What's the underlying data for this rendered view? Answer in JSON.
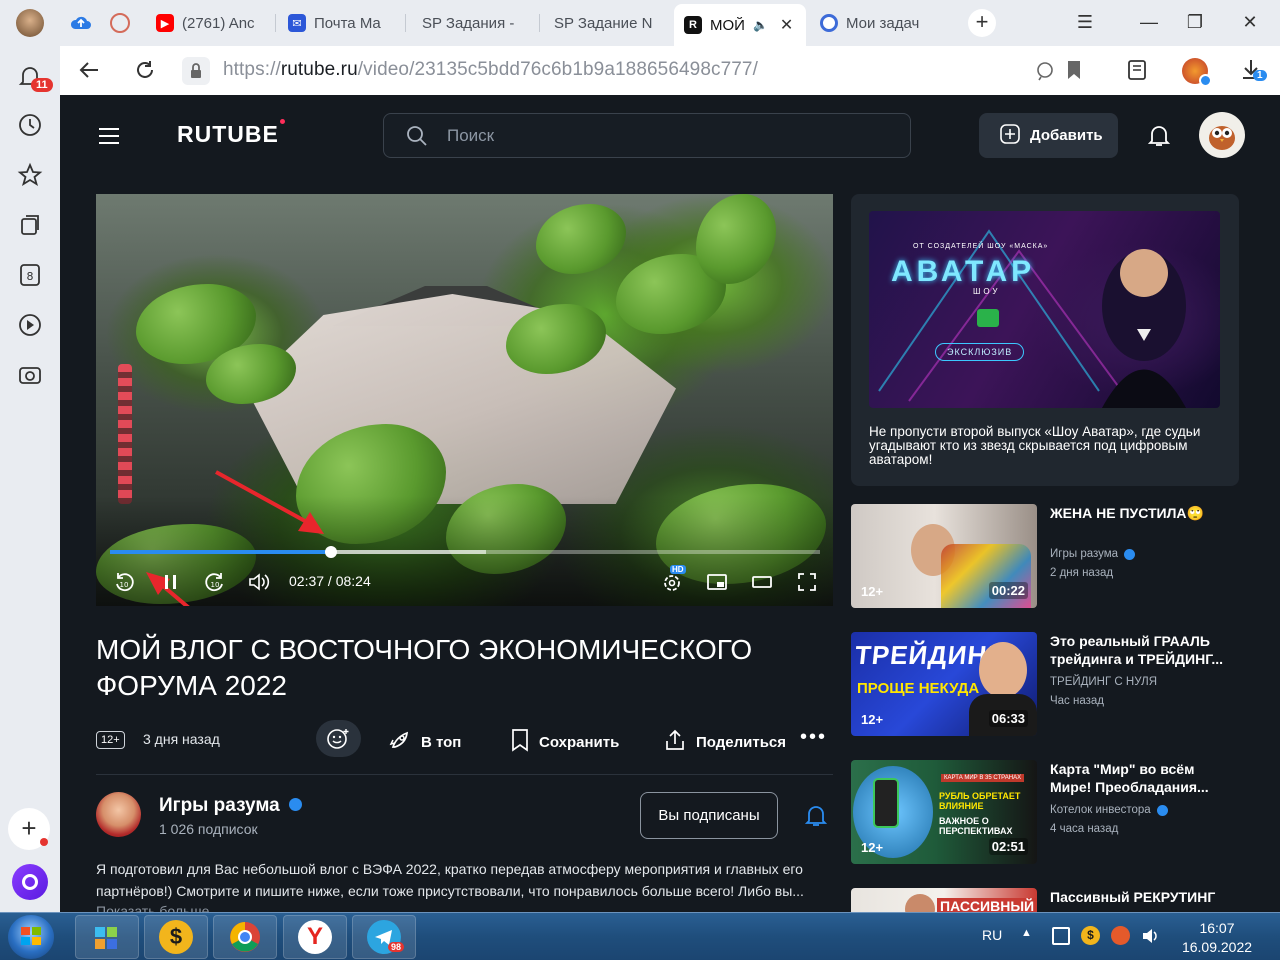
{
  "browser": {
    "tabs": [
      {
        "label": "(2761) Anc",
        "favicon": "youtube-icon",
        "color": "#ff0000"
      },
      {
        "label": "Почта Ma",
        "favicon": "mail-icon",
        "color": "#2c57d8"
      },
      {
        "label": "SP Задания -",
        "favicon": "sp-icon",
        "color": "#e0356b"
      },
      {
        "label": "SP Задание N",
        "favicon": "sp-icon",
        "color": "#e0356b"
      },
      {
        "label": "МОЙ",
        "favicon": "rutube-icon",
        "color": "#111111",
        "active": true
      },
      {
        "label": "Мои задач",
        "favicon": "target-icon",
        "color": "#3d6bd8"
      }
    ],
    "url_scheme": "https://",
    "url_host": "rutube.ru",
    "url_path": "/video/23135c5bdd76c6b1b9a188656498c777/",
    "notification_count": "11",
    "downloads_count": "1"
  },
  "site": {
    "logo": "RUTUBE",
    "search_placeholder": "Поиск",
    "add_button": "Добавить",
    "accent": "#2a8cf0"
  },
  "player": {
    "current_time": "02:37",
    "duration": "08:24",
    "time_display": "02:37 / 08:24",
    "progress_fraction": 0.3115,
    "buffered_fraction": 0.53,
    "quality_badge": "HD"
  },
  "video": {
    "title": "МОЙ ВЛОГ С ВОСТОЧНОГО ЭКОНОМИЧЕСКОГО ФОРУМА 2022",
    "age_rating": "12+",
    "posted": "3 дня назад",
    "actions": {
      "top": "В топ",
      "save": "Сохранить",
      "share": "Поделиться"
    }
  },
  "channel": {
    "name": "Игры разума",
    "subscribers": "1 026 подписок",
    "subscribe_button": "Вы подписаны"
  },
  "description": {
    "text": "Я подготовил для Вас небольшой влог с ВЭФА 2022, кратко передав атмосферу мероприятия и главных его партнёров!) Смотрите и пишите ниже, если тоже присутствовали, что понравилось больше всего! Либо вы...",
    "more": "Показать больше"
  },
  "sidebar": {
    "promo": {
      "caption": "Не пропусти второй выпуск «Шоу Аватар», где судьи угадывают кто из звезд скрывается под цифровым аватаром!",
      "img_top": "ОТ СОЗДАТЕЛЕЙ ШОУ «МАСКА»",
      "img_title": "АВАТАР",
      "img_sub": "ШОУ",
      "img_badge": "ЭКСКЛЮЗИВ"
    },
    "recommendations": [
      {
        "title": "ЖЕНА НЕ ПУСТИЛА🙄",
        "channel": "Игры разума",
        "verified": true,
        "date": "2 дня назад",
        "age": "12+",
        "duration": "00:22"
      },
      {
        "title": "Это реальный ГРААЛЬ трейдинга и ТРЕЙДИНГ...",
        "channel": "ТРЕЙДИНГ С НУЛЯ",
        "verified": false,
        "date": "Час назад",
        "age": "12+",
        "duration": "06:33",
        "thumb_text1": "ТРЕЙДИНГ",
        "thumb_text2": "ПРОЩЕ НЕКУДА"
      },
      {
        "title": "Карта \"Мир\" во всём Мире! Преобладания...",
        "channel": "Котелок инвестора",
        "verified": true,
        "date": "4 часа назад",
        "age": "12+",
        "duration": "02:51",
        "thumb_text1": "КАРТА МИР В 35 СТРАНАХ",
        "thumb_text2": "РУБЛЬ ОБРЕТАЕТ ВЛИЯНИЕ",
        "thumb_text3": "ВАЖНОЕ О ПЕРСПЕКТИВАХ"
      },
      {
        "title": "Пассивный РЕКРУТИНГ",
        "channel": "",
        "verified": false,
        "date": "",
        "age": "",
        "duration": "",
        "thumb_text1": "ПАССИВНЫЙ"
      }
    ]
  },
  "taskbar": {
    "lang": "RU",
    "time": "16:07",
    "date": "16.09.2022",
    "telegram_badge": "98"
  }
}
